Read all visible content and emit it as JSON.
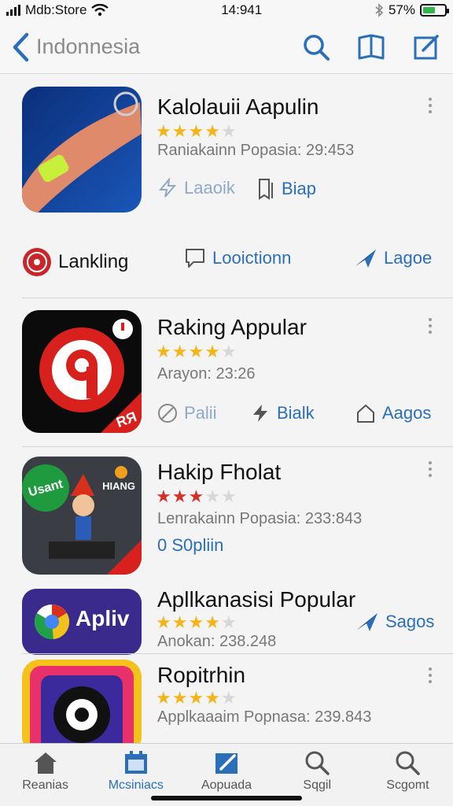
{
  "status": {
    "carrier": "Mdb:Store",
    "time": "14:941",
    "battery": "57%",
    "battery_level": 0.57,
    "wifi_icon": "wifi-icon",
    "bluetooth_icon": "bluetooth-icon"
  },
  "nav": {
    "back_title": "Indonnesia",
    "icons": [
      "search-icon",
      "book-icon",
      "compose-icon"
    ]
  },
  "apps": [
    {
      "name": "Kalolauii Aapulin",
      "rating": 4,
      "meta": "Raniakainn Popasia: 29:453",
      "actions": [
        {
          "label": "Laaoik",
          "icon": "flash-icon"
        },
        {
          "label": "Biap",
          "icon": "bookmark-icon"
        }
      ]
    },
    {
      "section_links": [
        {
          "label": "Lankling",
          "icon": "seal-icon"
        },
        {
          "label": "Looictionn",
          "icon": "speech-bubble-icon"
        },
        {
          "label": "Lagoe",
          "icon": "paper-plane-icon"
        }
      ]
    },
    {
      "name": "Raking Appular",
      "rating": 4,
      "meta": "Arayon: 23:26",
      "icon_badge": "RЯ",
      "actions": [
        {
          "label": "Palii",
          "icon": "no-entry-icon"
        },
        {
          "label": "Bialk",
          "icon": "flash-icon"
        },
        {
          "label": "Aagos",
          "icon": "house-icon"
        }
      ]
    },
    {
      "name": "Hakip Fholat",
      "rating": 3,
      "meta": "Lenrakainn Popasia: 233:843",
      "icon_label_left": "Usant",
      "icon_label_right": "HIANG",
      "actions": [
        {
          "label": "0 S0pliin"
        }
      ]
    },
    {
      "name": "Apllkanasisi Popular",
      "rating": 4,
      "meta": "Anokan: 238.248",
      "icon_text": "Apliv",
      "actions": [
        {
          "label": "Sagos",
          "icon": "paper-plane-icon"
        }
      ]
    },
    {
      "name": "Ropitrhin",
      "rating": 4,
      "meta": "Applkaaaim Popnasa: 239.843"
    }
  ],
  "tabs": [
    {
      "label": "Reanias",
      "icon": "home-icon",
      "active": false
    },
    {
      "label": "Mcsiniacs",
      "icon": "calendar-icon",
      "active": true
    },
    {
      "label": "Aopuada",
      "icon": "pen-icon",
      "active": false
    },
    {
      "label": "Sqgil",
      "icon": "search-icon",
      "active": false
    },
    {
      "label": "Scgomt",
      "icon": "search-icon",
      "active": false
    }
  ],
  "colors": {
    "accent": "#2a6fb8",
    "star": "#f3b51b",
    "star_red": "#d6302a"
  }
}
